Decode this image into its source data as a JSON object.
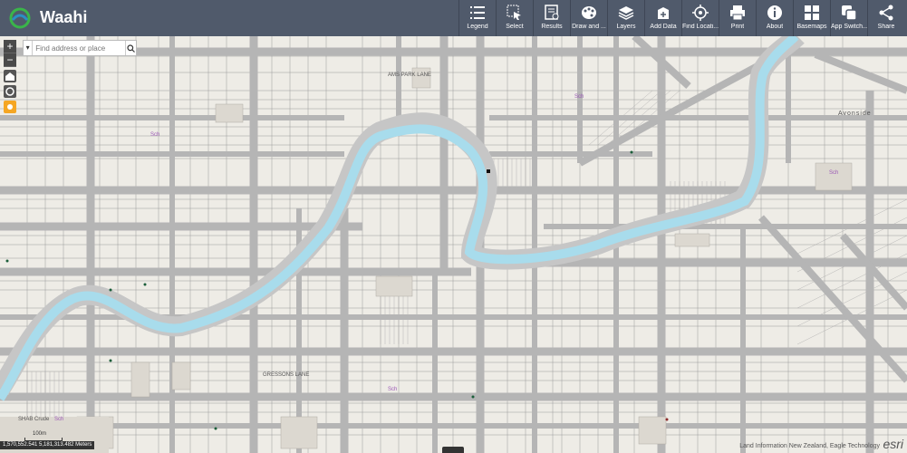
{
  "app": {
    "title": "Waahi"
  },
  "toolbar": [
    {
      "label": "Legend",
      "icon": "legend-icon"
    },
    {
      "label": "Select",
      "icon": "select-icon"
    },
    {
      "label": "Results",
      "icon": "results-icon"
    },
    {
      "label": "Draw and ...",
      "icon": "draw-icon"
    },
    {
      "label": "Layers",
      "icon": "layers-icon"
    },
    {
      "label": "Add Data",
      "icon": "add-data-icon"
    },
    {
      "label": "Find Locati...",
      "icon": "find-location-icon"
    },
    {
      "label": "Print",
      "icon": "print-icon"
    },
    {
      "label": "About",
      "icon": "about-icon"
    },
    {
      "label": "Basemaps",
      "icon": "basemaps-icon"
    },
    {
      "label": "App Switch...",
      "icon": "app-switcher-icon"
    },
    {
      "label": "Share",
      "icon": "share-icon"
    }
  ],
  "search": {
    "placeholder": "Find address or place"
  },
  "zoom": {
    "in": "+",
    "out": "−"
  },
  "map": {
    "labels": {
      "street_1": "AMS PARK LANE",
      "street_2": "Avonside",
      "street_3": "GRESSONS LANE",
      "street_4": "SHAB Crude",
      "sch_1": "Sch",
      "sch_2": "Sch",
      "sch_3": "Sch",
      "sch_4": "Sch",
      "sch_5": "Sch"
    },
    "scale": "100m",
    "coordinates": "1,570,552.541 5,181,313.482 Meters",
    "attribution": "Land Information New Zealand, Eagle Technology",
    "esri": "esri",
    "colors": {
      "river": "#a8dcec",
      "roads": "#b5b5b5",
      "land": "#eeece6",
      "parcel": "#9a9a9a"
    }
  }
}
